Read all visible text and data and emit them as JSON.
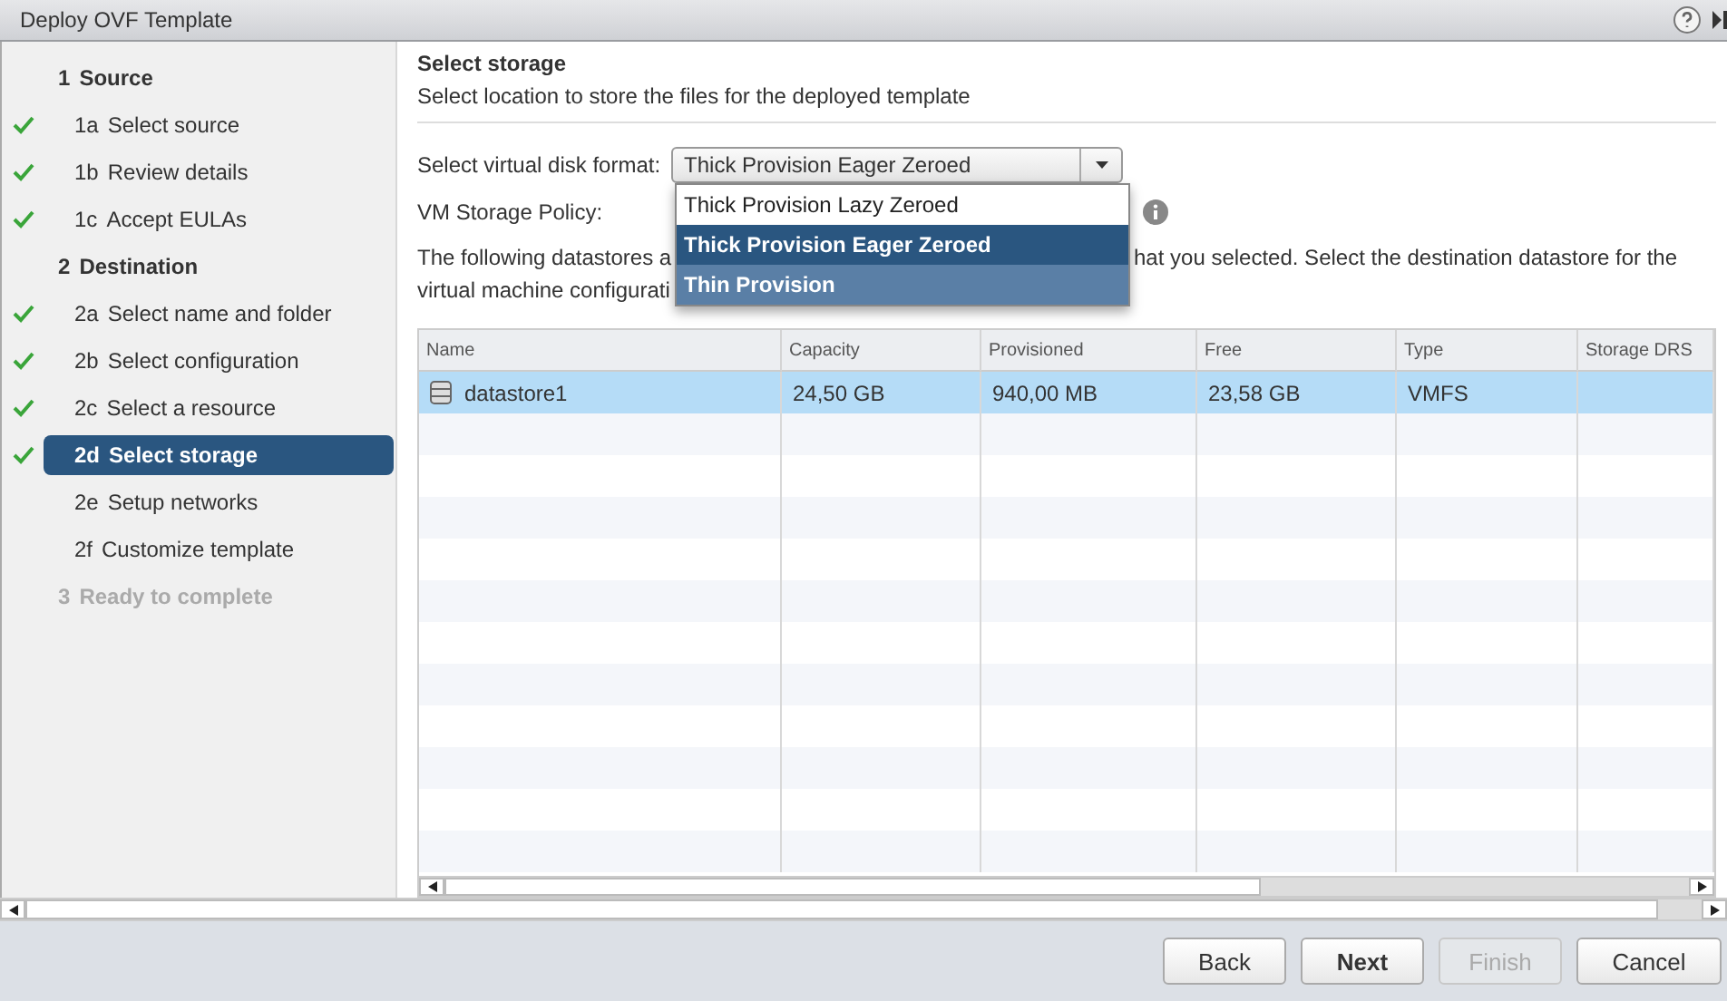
{
  "window": {
    "title": "Deploy OVF Template"
  },
  "steps": [
    {
      "number": "1",
      "label": "Source",
      "disabled": false,
      "children": [
        {
          "number": "1a",
          "label": "Select source",
          "checked": true,
          "selected": false
        },
        {
          "number": "1b",
          "label": "Review details",
          "checked": true,
          "selected": false
        },
        {
          "number": "1c",
          "label": "Accept EULAs",
          "checked": true,
          "selected": false
        }
      ]
    },
    {
      "number": "2",
      "label": "Destination",
      "disabled": false,
      "children": [
        {
          "number": "2a",
          "label": "Select name and folder",
          "checked": true,
          "selected": false
        },
        {
          "number": "2b",
          "label": "Select configuration",
          "checked": true,
          "selected": false
        },
        {
          "number": "2c",
          "label": "Select a resource",
          "checked": true,
          "selected": false
        },
        {
          "number": "2d",
          "label": "Select storage",
          "checked": true,
          "selected": true
        },
        {
          "number": "2e",
          "label": "Setup networks",
          "checked": false,
          "selected": false
        },
        {
          "number": "2f",
          "label": "Customize template",
          "checked": false,
          "selected": false
        }
      ]
    },
    {
      "number": "3",
      "label": "Ready to complete",
      "disabled": true
    }
  ],
  "page": {
    "title": "Select storage",
    "subtitle": "Select location to store the files for the deployed template"
  },
  "disk_format": {
    "label": "Select virtual disk format:",
    "value": "Thick Provision Eager Zeroed",
    "options": [
      {
        "label": "Thick Provision Lazy Zeroed",
        "selected": false,
        "hovered": false
      },
      {
        "label": "Thick Provision Eager Zeroed",
        "selected": true,
        "hovered": false
      },
      {
        "label": "Thin Provision",
        "selected": false,
        "hovered": true
      }
    ]
  },
  "storage_policy": {
    "label": "VM Storage Policy:"
  },
  "description": {
    "line1_left": "The following datastores a",
    "line1_right": "hat you selected. Select the destination datastore for the",
    "line2_left": "virtual machine configurati"
  },
  "table": {
    "columns": [
      "Name",
      "Capacity",
      "Provisioned",
      "Free",
      "Type",
      "Storage DRS"
    ],
    "rows": [
      {
        "selected": true,
        "cells": [
          "datastore1",
          "24,50 GB",
          "940,00 MB",
          "23,58 GB",
          "VMFS",
          ""
        ]
      }
    ]
  },
  "buttons": [
    {
      "label": "Back",
      "primary": false,
      "disabled": false
    },
    {
      "label": "Next",
      "primary": true,
      "disabled": false
    },
    {
      "label": "Finish",
      "primary": false,
      "disabled": true
    },
    {
      "label": "Cancel",
      "primary": false,
      "disabled": false
    }
  ]
}
